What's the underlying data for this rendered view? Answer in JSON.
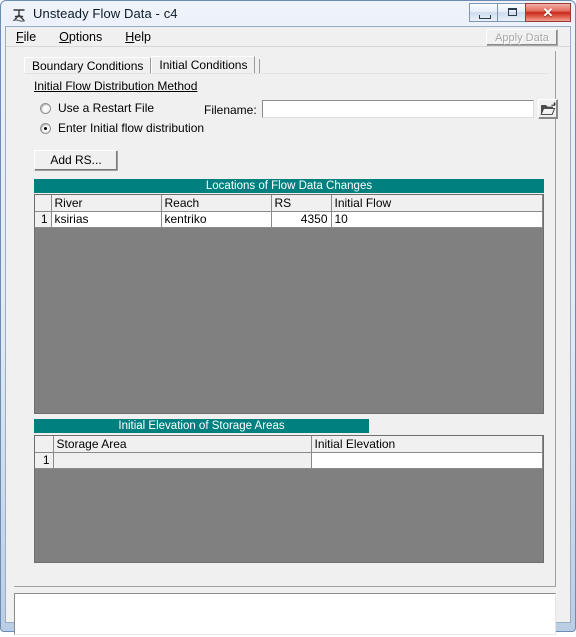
{
  "window": {
    "title": "Unsteady Flow Data - c4",
    "icon": "app-icon",
    "buttons": {
      "minimize": "minimize-icon",
      "maximize": "maximize-icon",
      "close": "✕"
    }
  },
  "menubar": {
    "items": [
      {
        "label": "File",
        "accel": "F"
      },
      {
        "label": "Options",
        "accel": "O"
      },
      {
        "label": "Help",
        "accel": "H"
      }
    ]
  },
  "toolbar": {
    "apply_label": "Apply Data",
    "apply_enabled": false
  },
  "tabs": [
    {
      "label": "Boundary Conditions",
      "active": false
    },
    {
      "label": "Initial Conditions",
      "active": true
    }
  ],
  "group": {
    "title": "Initial Flow Distribution Method"
  },
  "radios": [
    {
      "label": "Use a Restart File",
      "checked": false
    },
    {
      "label": "Enter Initial flow distribution",
      "checked": true
    }
  ],
  "filename": {
    "label": "Filename:",
    "value": "",
    "placeholder": "",
    "browse_icon": "open-folder-icon"
  },
  "add_rs": {
    "label": "Add RS..."
  },
  "flow_table": {
    "header": "Locations of Flow Data Changes",
    "columns": [
      "River",
      "Reach",
      "RS",
      "Initial Flow"
    ],
    "rows": [
      {
        "index": "1",
        "river": "ksirias",
        "reach": "kentriko",
        "rs": "4350",
        "initial_flow": "10"
      }
    ]
  },
  "storage_table": {
    "header": "Initial Elevation of Storage Areas",
    "columns": [
      "Storage Area",
      "Initial Elevation"
    ],
    "rows": [
      {
        "index": "1",
        "storage_area": "",
        "initial_elevation": ""
      }
    ]
  },
  "message_box": {
    "value": "",
    "placeholder": ""
  },
  "colors": {
    "teal_header": "#00807f",
    "grid_empty": "#808080",
    "window_face": "#f0f0f0",
    "close_button": "#c5291c"
  }
}
